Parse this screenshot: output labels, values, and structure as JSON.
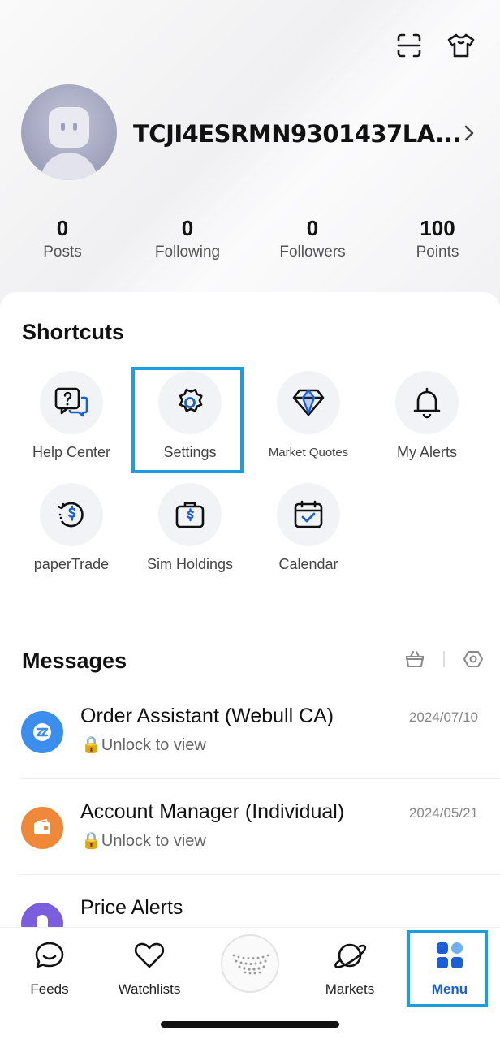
{
  "header": {
    "username": "TCJI4ESRMN9301437LA...",
    "scan_icon": "scan-icon",
    "skin_icon": "tshirt-icon"
  },
  "stats": [
    {
      "value": "0",
      "label": "Posts"
    },
    {
      "value": "0",
      "label": "Following"
    },
    {
      "value": "0",
      "label": "Followers"
    },
    {
      "value": "100",
      "label": "Points"
    }
  ],
  "shortcuts": {
    "title": "Shortcuts",
    "items": [
      {
        "label": "Help Center",
        "icon": "help-chat-icon"
      },
      {
        "label": "Settings",
        "icon": "gear-icon"
      },
      {
        "label": "Market Quotes",
        "icon": "diamond-icon"
      },
      {
        "label": "My Alerts",
        "icon": "bell-icon"
      },
      {
        "label": "paperTrade",
        "icon": "dollar-cycle-icon"
      },
      {
        "label": "Sim Holdings",
        "icon": "briefcase-dollar-icon"
      },
      {
        "label": "Calendar",
        "icon": "calendar-check-icon"
      }
    ]
  },
  "messages": {
    "title": "Messages",
    "items": [
      {
        "title": "Order Assistant (Webull CA)",
        "subtitle": "🔒Unlock to view",
        "date": "2024/07/10",
        "color": "#3b8ef0"
      },
      {
        "title": "Account Manager (Individual)",
        "subtitle": "🔒Unlock to view",
        "date": "2024/05/21",
        "color": "#f0883a"
      },
      {
        "title": "Price Alerts",
        "subtitle": "",
        "date": "",
        "color": "#7b5ee0"
      }
    ]
  },
  "tabbar": {
    "tabs": [
      {
        "label": "Feeds"
      },
      {
        "label": "Watchlists"
      },
      {
        "label": "Markets"
      },
      {
        "label": "Menu"
      }
    ],
    "active_color": "#1a5fd6",
    "highlight_color": "#1a9ee0"
  }
}
